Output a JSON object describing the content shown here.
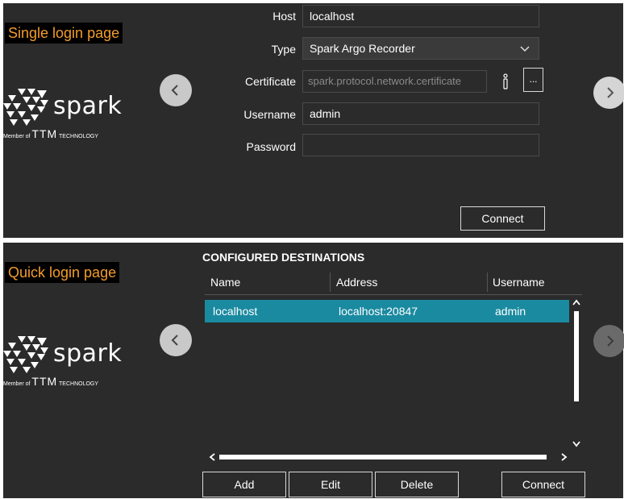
{
  "single": {
    "page_label": "Single login page",
    "logo": {
      "word": "spark",
      "member_prefix": "Member of",
      "ttm": "TTM",
      "technology": "TECHNOLOGY"
    },
    "fields": {
      "host": {
        "label": "Host",
        "value": "localhost"
      },
      "type": {
        "label": "Type",
        "value": "Spark Argo Recorder"
      },
      "certificate": {
        "label": "Certificate",
        "value": "spark.protocol.network.certificate",
        "browse_label": "..."
      },
      "username": {
        "label": "Username",
        "value": "admin"
      },
      "password": {
        "label": "Password",
        "value": ""
      }
    },
    "connect_label": "Connect"
  },
  "quick": {
    "page_label": "Quick login page",
    "logo": {
      "word": "spark",
      "member_prefix": "Member of",
      "ttm": "TTM",
      "technology": "TECHNOLOGY"
    },
    "section_title": "CONFIGURED DESTINATIONS",
    "columns": [
      "Name",
      "Address",
      "Username"
    ],
    "rows": [
      {
        "name": "localhost",
        "address": "localhost:20847",
        "username": "admin",
        "selected": true
      }
    ],
    "buttons": {
      "add": "Add",
      "edit": "Edit",
      "delete": "Delete",
      "connect": "Connect"
    }
  },
  "colors": {
    "panel": "#2b2b2b",
    "accent_orange": "#f39c2b",
    "selection": "#1a8aa0"
  },
  "icons": [
    "chevron-left-icon",
    "chevron-right-icon",
    "chevron-down-icon",
    "info-icon",
    "spark-logo-icon"
  ]
}
